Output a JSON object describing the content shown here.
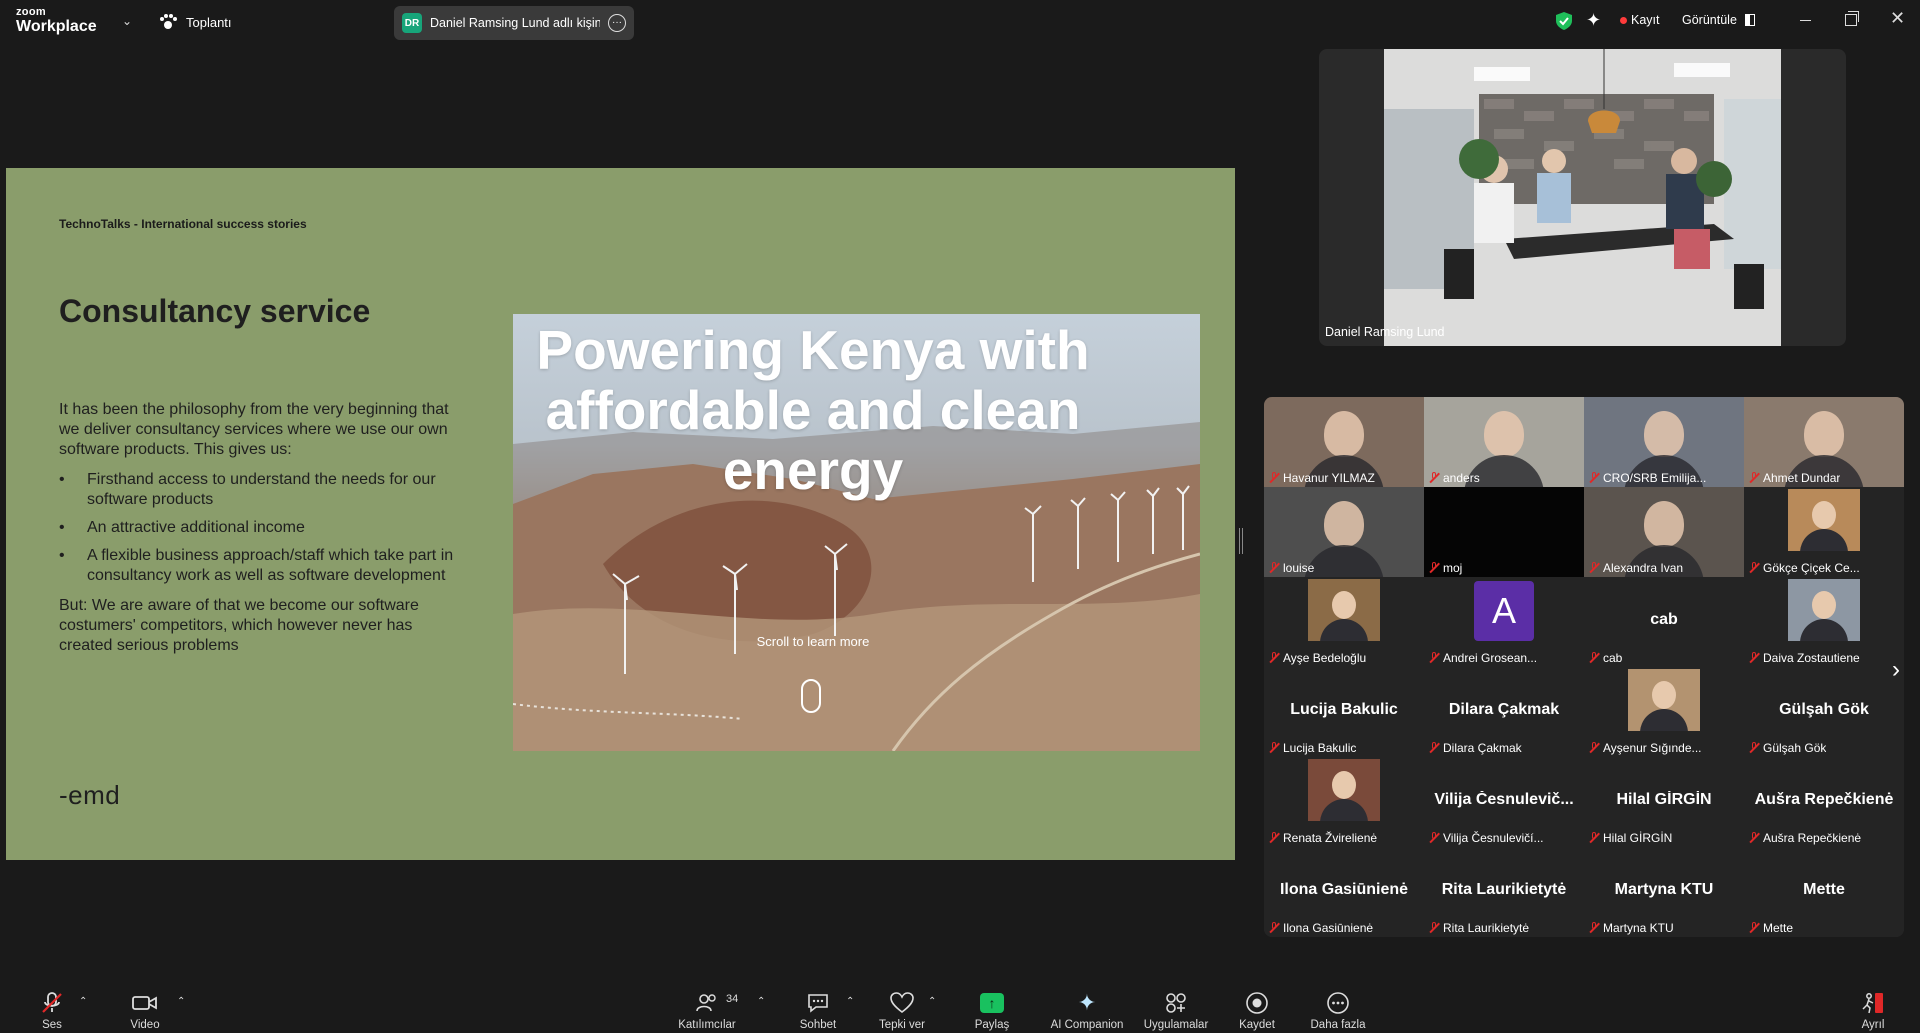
{
  "app": {
    "logo_top": "zoom",
    "logo_bottom": "Workplace"
  },
  "topbar": {
    "meeting_label": "Toplantı",
    "share_tab": {
      "initials": "DR",
      "title": "Daniel Ramsing Lund adlı kişinin e"
    },
    "record_label": "Kayıt",
    "view_label": "Görüntüle"
  },
  "slide": {
    "header": "TechnoTalks - International success stories",
    "title": "Consultancy service",
    "intro": "It has been the philosophy from the very beginning that we deliver consultancy services where we use our own software products. This gives us:",
    "bullets": [
      "Firsthand access to understand the needs for our software products",
      "An attractive additional income",
      "A flexible business approach/staff which take part in consultancy work as well as software development"
    ],
    "outro": "But: We are aware of that we become our software costumers' competitors, which however never has created serious problems",
    "logo_text": "-emd",
    "hero": {
      "title": "Powering Kenya with affordable and clean energy",
      "scroll_text": "Scroll to learn more"
    }
  },
  "speaker": {
    "name": "Daniel Ramsing Lund"
  },
  "gallery": {
    "tiles": [
      {
        "label": "Havanur YILMAZ",
        "big": "",
        "kind": "video",
        "color": "#7d6a5d"
      },
      {
        "label": "anders",
        "big": "",
        "kind": "video",
        "color": "#a6a49c"
      },
      {
        "label": "CRO/SRB Emilija...",
        "big": "",
        "kind": "video",
        "color": "#6f7580"
      },
      {
        "label": "Ahmet Dundar",
        "big": "",
        "kind": "video",
        "color": "#8a7a6d"
      },
      {
        "label": "louise",
        "big": "",
        "kind": "video",
        "color": "#4e4e4e"
      },
      {
        "label": "moj",
        "big": "",
        "kind": "black",
        "color": "#050505"
      },
      {
        "label": "Alexandra Ivan",
        "big": "",
        "kind": "video",
        "color": "#5b544e"
      },
      {
        "label": "Gökçe Çiçek Ce...",
        "big": "",
        "kind": "photo",
        "color": "#b88a5a"
      },
      {
        "label": "Ayşe Bedeloğlu",
        "big": "",
        "kind": "photo",
        "color": "#8b6b47"
      },
      {
        "label": "Andrei Grosean...",
        "big": "A",
        "kind": "avatar",
        "color": "#5b2ea6"
      },
      {
        "label": "cab",
        "big": "cab",
        "kind": "name",
        "color": "#242424"
      },
      {
        "label": "Daiva Zostautiene",
        "big": "",
        "kind": "photo",
        "color": "#8d97a3"
      },
      {
        "label": "Lucija Bakulic",
        "big": "Lucija Bakulic",
        "kind": "name",
        "color": "#242424"
      },
      {
        "label": "Dilara Çakmak",
        "big": "Dilara Çakmak",
        "kind": "name",
        "color": "#242424"
      },
      {
        "label": "Ayşenur Sığınde...",
        "big": "",
        "kind": "photo",
        "color": "#b39370"
      },
      {
        "label": "Gülşah Gök",
        "big": "Gülşah Gök",
        "kind": "name",
        "color": "#242424"
      },
      {
        "label": "Renata Žvirelienė",
        "big": "",
        "kind": "photo",
        "color": "#7a4a3a"
      },
      {
        "label": "Vilija Česnulevičí...",
        "big": "Vilija  Česnulevič...",
        "kind": "name",
        "color": "#242424"
      },
      {
        "label": "Hilal GİRGİN",
        "big": "Hilal GİRGİN",
        "kind": "name",
        "color": "#242424"
      },
      {
        "label": "Aušra Repečkienė",
        "big": "Aušra Repečkienė",
        "kind": "name",
        "color": "#242424"
      },
      {
        "label": "Ilona Gasiūnienė",
        "big": "Ilona Gasiūnienė",
        "kind": "name",
        "color": "#242424"
      },
      {
        "label": "Rita Laurikietytė",
        "big": "Rita Laurikietytė",
        "kind": "name",
        "color": "#242424"
      },
      {
        "label": "Martyna KTU",
        "big": "Martyna KTU",
        "kind": "name",
        "color": "#242424"
      },
      {
        "label": "Mette",
        "big": "Mette",
        "kind": "name",
        "color": "#242424"
      }
    ]
  },
  "toolbar": {
    "audio": "Ses",
    "video": "Video",
    "participants": "Katılımcılar",
    "participants_count": "34",
    "chat": "Sohbet",
    "react": "Tepki ver",
    "share": "Paylaş",
    "ai": "AI Companion",
    "apps": "Uygulamalar",
    "record": "Kaydet",
    "more": "Daha fazla",
    "leave": "Ayrıl"
  },
  "colors": {
    "slide_bg": "#8a9d6b",
    "share_green": "#19c15f",
    "muted_red": "#e02828",
    "avatar_purple": "#5b2ea6"
  }
}
